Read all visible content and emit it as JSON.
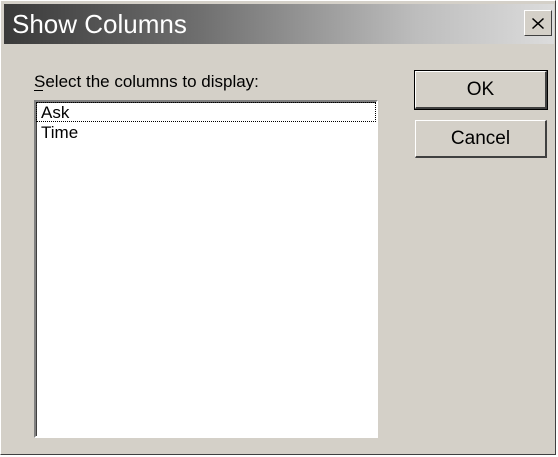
{
  "window": {
    "title": "Show Columns",
    "close_icon": "close-icon"
  },
  "prompt": {
    "label": "Select the columns to display:"
  },
  "columns_list": {
    "items": [
      "Ask",
      "Time"
    ],
    "focused_item": "Ask"
  },
  "buttons": {
    "ok_label": "OK",
    "cancel_label": "Cancel"
  }
}
